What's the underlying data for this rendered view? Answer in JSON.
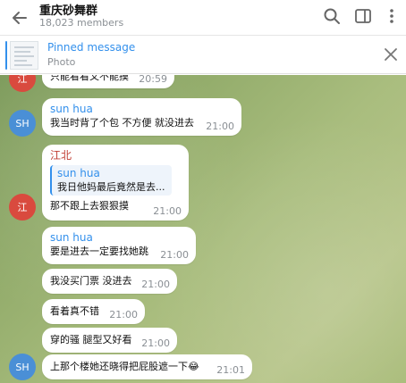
{
  "header": {
    "title": "重庆砂舞群",
    "members": "18,023 members"
  },
  "pinned": {
    "title": "Pinned message",
    "subtitle": "Photo"
  },
  "messages": [
    {
      "avatar": "江",
      "text": "只能看看又不能摸",
      "time": "20:59"
    },
    {
      "avatar": "SH",
      "sender": "sun hua",
      "text": "我当时背了个包 不方便 就没进去",
      "time": "21:00"
    },
    {
      "avatar": "江",
      "sender": "江北",
      "reply_name": "sun hua",
      "reply_text": "我日他妈最后竟然是去...",
      "text": "那不跟上去狠狠摸",
      "time": "21:00"
    },
    {
      "sender": "sun hua",
      "text": "要是进去一定要找她跳",
      "time": "21:00"
    },
    {
      "text": "我没买门票 没进去",
      "time": "21:00"
    },
    {
      "text": "看着真不错",
      "time": "21:00"
    },
    {
      "text": "穿的骚 腿型又好看",
      "time": "21:00"
    },
    {
      "avatar": "SH",
      "text": "上那个楼她还晓得把屁股遮一下😂",
      "time": "21:01"
    }
  ],
  "colors": {
    "accent": "#3390ec",
    "sender_red": "#c03d33",
    "avatar_sh": "#4a8fd6",
    "avatar_js": "#d94a3e"
  }
}
